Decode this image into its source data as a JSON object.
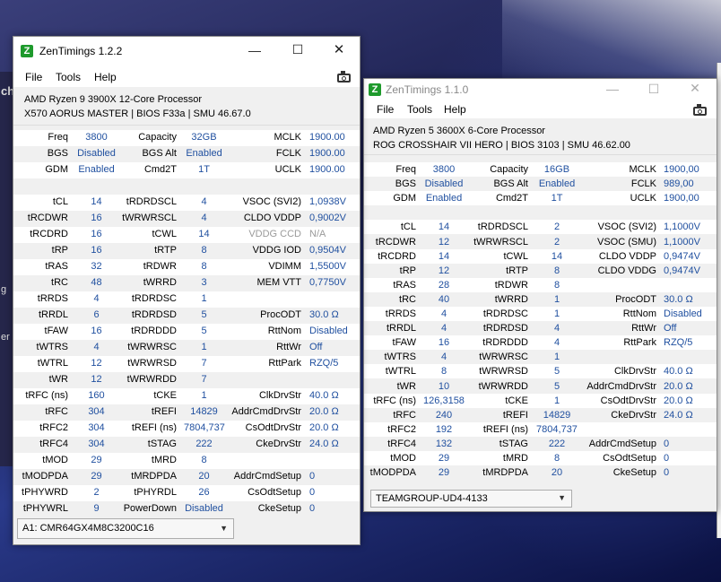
{
  "background": {
    "left_strip_fragments": [
      "che",
      "g",
      "er"
    ]
  },
  "window1": {
    "title": "ZenTimings 1.2.2",
    "icon_letter": "Z",
    "menu": [
      "File",
      "Tools",
      "Help"
    ],
    "cpu": "AMD Ryzen 9 3900X 12-Core Processor",
    "board": "X570 AORUS MASTER | BIOS F33a | SMU 46.67.0",
    "rows": [
      [
        [
          "Freq",
          "3800"
        ],
        [
          "Capacity",
          "32GB"
        ],
        [
          "MCLK",
          "1900.00"
        ]
      ],
      [
        [
          "BGS",
          "Disabled"
        ],
        [
          "BGS Alt",
          "Enabled"
        ],
        [
          "FCLK",
          "1900.00"
        ]
      ],
      [
        [
          "GDM",
          "Enabled"
        ],
        [
          "Cmd2T",
          "1T"
        ],
        [
          "UCLK",
          "1900.00"
        ]
      ],
      [
        [
          "",
          ""
        ],
        [
          "",
          ""
        ],
        [
          "",
          ""
        ]
      ],
      [
        [
          "tCL",
          "14"
        ],
        [
          "tRDRDSCL",
          "4"
        ],
        [
          "VSOC (SVI2)",
          "1,0938V"
        ]
      ],
      [
        [
          "tRCDWR",
          "16"
        ],
        [
          "tWRWRSCL",
          "4"
        ],
        [
          "CLDO VDDP",
          "0,9002V"
        ]
      ],
      [
        [
          "tRCDRD",
          "16"
        ],
        [
          "tCWL",
          "14"
        ],
        [
          "VDDG CCD",
          "N/A"
        ]
      ],
      [
        [
          "tRP",
          "16"
        ],
        [
          "tRTP",
          "8"
        ],
        [
          "VDDG IOD",
          "0,9504V"
        ]
      ],
      [
        [
          "tRAS",
          "32"
        ],
        [
          "tRDWR",
          "8"
        ],
        [
          "VDIMM",
          "1,5500V"
        ]
      ],
      [
        [
          "tRC",
          "48"
        ],
        [
          "tWRRD",
          "3"
        ],
        [
          "MEM VTT",
          "0,7750V"
        ]
      ],
      [
        [
          "tRRDS",
          "4"
        ],
        [
          "tRDRDSC",
          "1"
        ],
        [
          "",
          ""
        ]
      ],
      [
        [
          "tRRDL",
          "6"
        ],
        [
          "tRDRDSD",
          "5"
        ],
        [
          "ProcODT",
          "30.0 Ω"
        ]
      ],
      [
        [
          "tFAW",
          "16"
        ],
        [
          "tRDRDDD",
          "5"
        ],
        [
          "RttNom",
          "Disabled"
        ]
      ],
      [
        [
          "tWTRS",
          "4"
        ],
        [
          "tWRWRSC",
          "1"
        ],
        [
          "RttWr",
          "Off"
        ]
      ],
      [
        [
          "tWTRL",
          "12"
        ],
        [
          "tWRWRSD",
          "7"
        ],
        [
          "RttPark",
          "RZQ/5"
        ]
      ],
      [
        [
          "tWR",
          "12"
        ],
        [
          "tWRWRDD",
          "7"
        ],
        [
          "",
          ""
        ]
      ],
      [
        [
          "tRFC (ns)",
          "160"
        ],
        [
          "tCKE",
          "1"
        ],
        [
          "ClkDrvStr",
          "40.0 Ω"
        ]
      ],
      [
        [
          "tRFC",
          "304"
        ],
        [
          "tREFI",
          "14829"
        ],
        [
          "AddrCmdDrvStr",
          "20.0 Ω"
        ]
      ],
      [
        [
          "tRFC2",
          "304"
        ],
        [
          "tREFI (ns)",
          "7804,737"
        ],
        [
          "CsOdtDrvStr",
          "20.0 Ω"
        ]
      ],
      [
        [
          "tRFC4",
          "304"
        ],
        [
          "tSTAG",
          "222"
        ],
        [
          "CkeDrvStr",
          "24.0 Ω"
        ]
      ],
      [
        [
          "tMOD",
          "29"
        ],
        [
          "tMRD",
          "8"
        ],
        [
          "",
          ""
        ]
      ],
      [
        [
          "tMODPDA",
          "29"
        ],
        [
          "tMRDPDA",
          "20"
        ],
        [
          "AddrCmdSetup",
          "0"
        ]
      ],
      [
        [
          "tPHYWRD",
          "2"
        ],
        [
          "tPHYRDL",
          "26"
        ],
        [
          "CsOdtSetup",
          "0"
        ]
      ],
      [
        [
          "tPHYWRL",
          "9"
        ],
        [
          "PowerDown",
          "Disabled"
        ],
        [
          "CkeSetup",
          "0"
        ]
      ]
    ],
    "dimm": "A1: CMR64GX4M8C3200C16"
  },
  "window2": {
    "title": "ZenTimings 1.1.0",
    "icon_letter": "Z",
    "menu": [
      "File",
      "Tools",
      "Help"
    ],
    "cpu": "AMD Ryzen 5 3600X 6-Core Processor",
    "board": "ROG CROSSHAIR VII HERO | BIOS 3103 | SMU 46.62.00",
    "rows": [
      [
        [
          "Freq",
          "3800"
        ],
        [
          "Capacity",
          "16GB"
        ],
        [
          "MCLK",
          "1900,00"
        ]
      ],
      [
        [
          "BGS",
          "Disabled"
        ],
        [
          "BGS Alt",
          "Enabled"
        ],
        [
          "FCLK",
          "989,00"
        ]
      ],
      [
        [
          "GDM",
          "Enabled"
        ],
        [
          "Cmd2T",
          "1T"
        ],
        [
          "UCLK",
          "1900,00"
        ]
      ],
      [
        [
          "",
          ""
        ],
        [
          "",
          ""
        ],
        [
          "",
          ""
        ]
      ],
      [
        [
          "tCL",
          "14"
        ],
        [
          "tRDRDSCL",
          "2"
        ],
        [
          "VSOC (SVI2)",
          "1,1000V"
        ]
      ],
      [
        [
          "tRCDWR",
          "12"
        ],
        [
          "tWRWRSCL",
          "2"
        ],
        [
          "VSOC (SMU)",
          "1,1000V"
        ]
      ],
      [
        [
          "tRCDRD",
          "14"
        ],
        [
          "tCWL",
          "14"
        ],
        [
          "CLDO VDDP",
          "0,9474V"
        ]
      ],
      [
        [
          "tRP",
          "12"
        ],
        [
          "tRTP",
          "8"
        ],
        [
          "CLDO VDDG",
          "0,9474V"
        ]
      ],
      [
        [
          "tRAS",
          "28"
        ],
        [
          "tRDWR",
          "8"
        ],
        [
          "",
          ""
        ]
      ],
      [
        [
          "tRC",
          "40"
        ],
        [
          "tWRRD",
          "1"
        ],
        [
          "ProcODT",
          "30.0 Ω"
        ]
      ],
      [
        [
          "tRRDS",
          "4"
        ],
        [
          "tRDRDSC",
          "1"
        ],
        [
          "RttNom",
          "Disabled"
        ]
      ],
      [
        [
          "tRRDL",
          "4"
        ],
        [
          "tRDRDSD",
          "4"
        ],
        [
          "RttWr",
          "Off"
        ]
      ],
      [
        [
          "tFAW",
          "16"
        ],
        [
          "tRDRDDD",
          "4"
        ],
        [
          "RttPark",
          "RZQ/5"
        ]
      ],
      [
        [
          "tWTRS",
          "4"
        ],
        [
          "tWRWRSC",
          "1"
        ],
        [
          "",
          ""
        ]
      ],
      [
        [
          "tWTRL",
          "8"
        ],
        [
          "tWRWRSD",
          "5"
        ],
        [
          "ClkDrvStr",
          "40.0 Ω"
        ]
      ],
      [
        [
          "tWR",
          "10"
        ],
        [
          "tWRWRDD",
          "5"
        ],
        [
          "AddrCmdDrvStr",
          "20.0 Ω"
        ]
      ],
      [
        [
          "tRFC (ns)",
          "126,3158"
        ],
        [
          "tCKE",
          "1"
        ],
        [
          "CsOdtDrvStr",
          "20.0 Ω"
        ]
      ],
      [
        [
          "tRFC",
          "240"
        ],
        [
          "tREFI",
          "14829"
        ],
        [
          "CkeDrvStr",
          "24.0 Ω"
        ]
      ],
      [
        [
          "tRFC2",
          "192"
        ],
        [
          "tREFI (ns)",
          "7804,737"
        ],
        [
          "",
          ""
        ]
      ],
      [
        [
          "tRFC4",
          "132"
        ],
        [
          "tSTAG",
          "222"
        ],
        [
          "AddrCmdSetup",
          "0"
        ]
      ],
      [
        [
          "tMOD",
          "29"
        ],
        [
          "tMRD",
          "8"
        ],
        [
          "CsOdtSetup",
          "0"
        ]
      ],
      [
        [
          "tMODPDA",
          "29"
        ],
        [
          "tMRDPDA",
          "20"
        ],
        [
          "CkeSetup",
          "0"
        ]
      ]
    ],
    "dimm": "TEAMGROUP-UD4-4133"
  }
}
